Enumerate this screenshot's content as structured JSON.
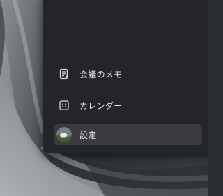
{
  "menu": {
    "items": [
      {
        "label": "会議のメモ",
        "icon": "note-icon",
        "active": false
      },
      {
        "label": "カレンダー",
        "icon": "calendar-icon",
        "active": false
      },
      {
        "label": "設定",
        "icon": "avatar",
        "active": true
      }
    ]
  },
  "colors": {
    "menu_background": "#232528",
    "active_item": "#393b3e",
    "text": "#e6e6e6",
    "icon": "#d8d8d8"
  }
}
